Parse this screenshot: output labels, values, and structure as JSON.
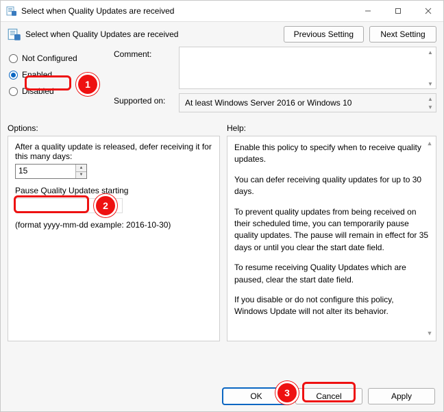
{
  "title": "Select when Quality Updates are received",
  "header": {
    "title": "Select when Quality Updates are received",
    "previous": "Previous Setting",
    "next": "Next Setting"
  },
  "radios": {
    "not_configured": "Not Configured",
    "enabled": "Enabled",
    "disabled": "Disabled"
  },
  "labels": {
    "comment": "Comment:",
    "supported_on": "Supported on:",
    "options": "Options:",
    "help": "Help:"
  },
  "supported_text": "At least Windows Server 2016 or Windows 10",
  "options": {
    "defer_label": "After a quality update is released, defer receiving it for this many days:",
    "defer_value": "15",
    "pause_label": "Pause Quality Updates starting",
    "pause_value": "",
    "format_hint": "(format yyyy-mm-dd example: 2016-10-30)"
  },
  "help": {
    "p1": "Enable this policy to specify when to receive quality updates.",
    "p2": "You can defer receiving quality updates for up to 30 days.",
    "p3": "To prevent quality updates from being received on their scheduled time, you can temporarily pause quality updates. The pause will remain in effect for 35 days or until you clear the start date field.",
    "p4": "To resume receiving Quality Updates which are paused, clear the start date field.",
    "p5": "If you disable or do not configure this policy, Windows Update will not alter its behavior."
  },
  "footer": {
    "ok": "OK",
    "cancel": "Cancel",
    "apply": "Apply"
  },
  "annotations": {
    "b1": "1",
    "b2": "2",
    "b3": "3"
  }
}
